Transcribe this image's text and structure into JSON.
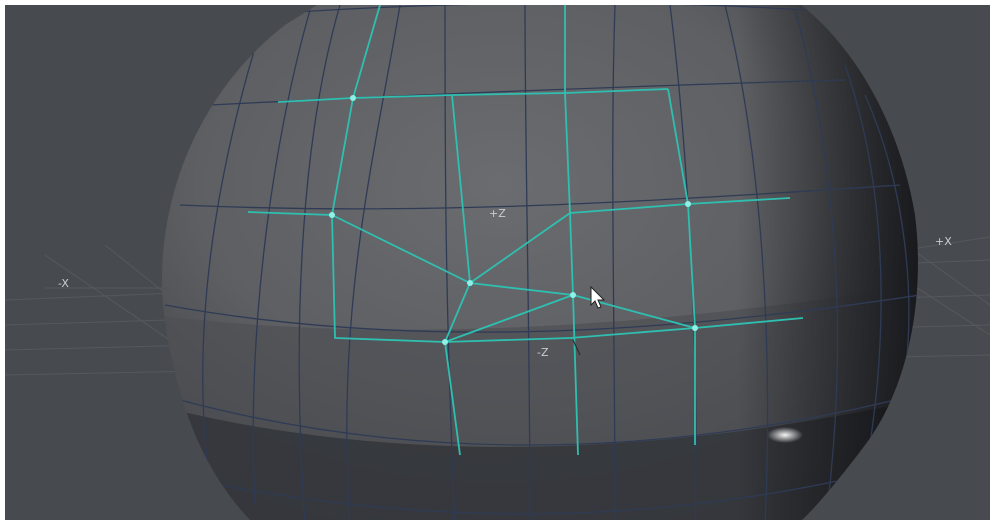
{
  "viewport": {
    "axis_labels": {
      "neg_x": "-X",
      "pos_x": "+X",
      "pos_z": "+Z",
      "neg_z": "-Z"
    },
    "colors": {
      "background": "#474a4e",
      "mesh_face": "#5f6164",
      "mesh_edge": "#2f3b55",
      "selection": "#2fbfb0",
      "grid": "#595d62"
    },
    "cursor_icon": "arrow-pointer-icon"
  }
}
